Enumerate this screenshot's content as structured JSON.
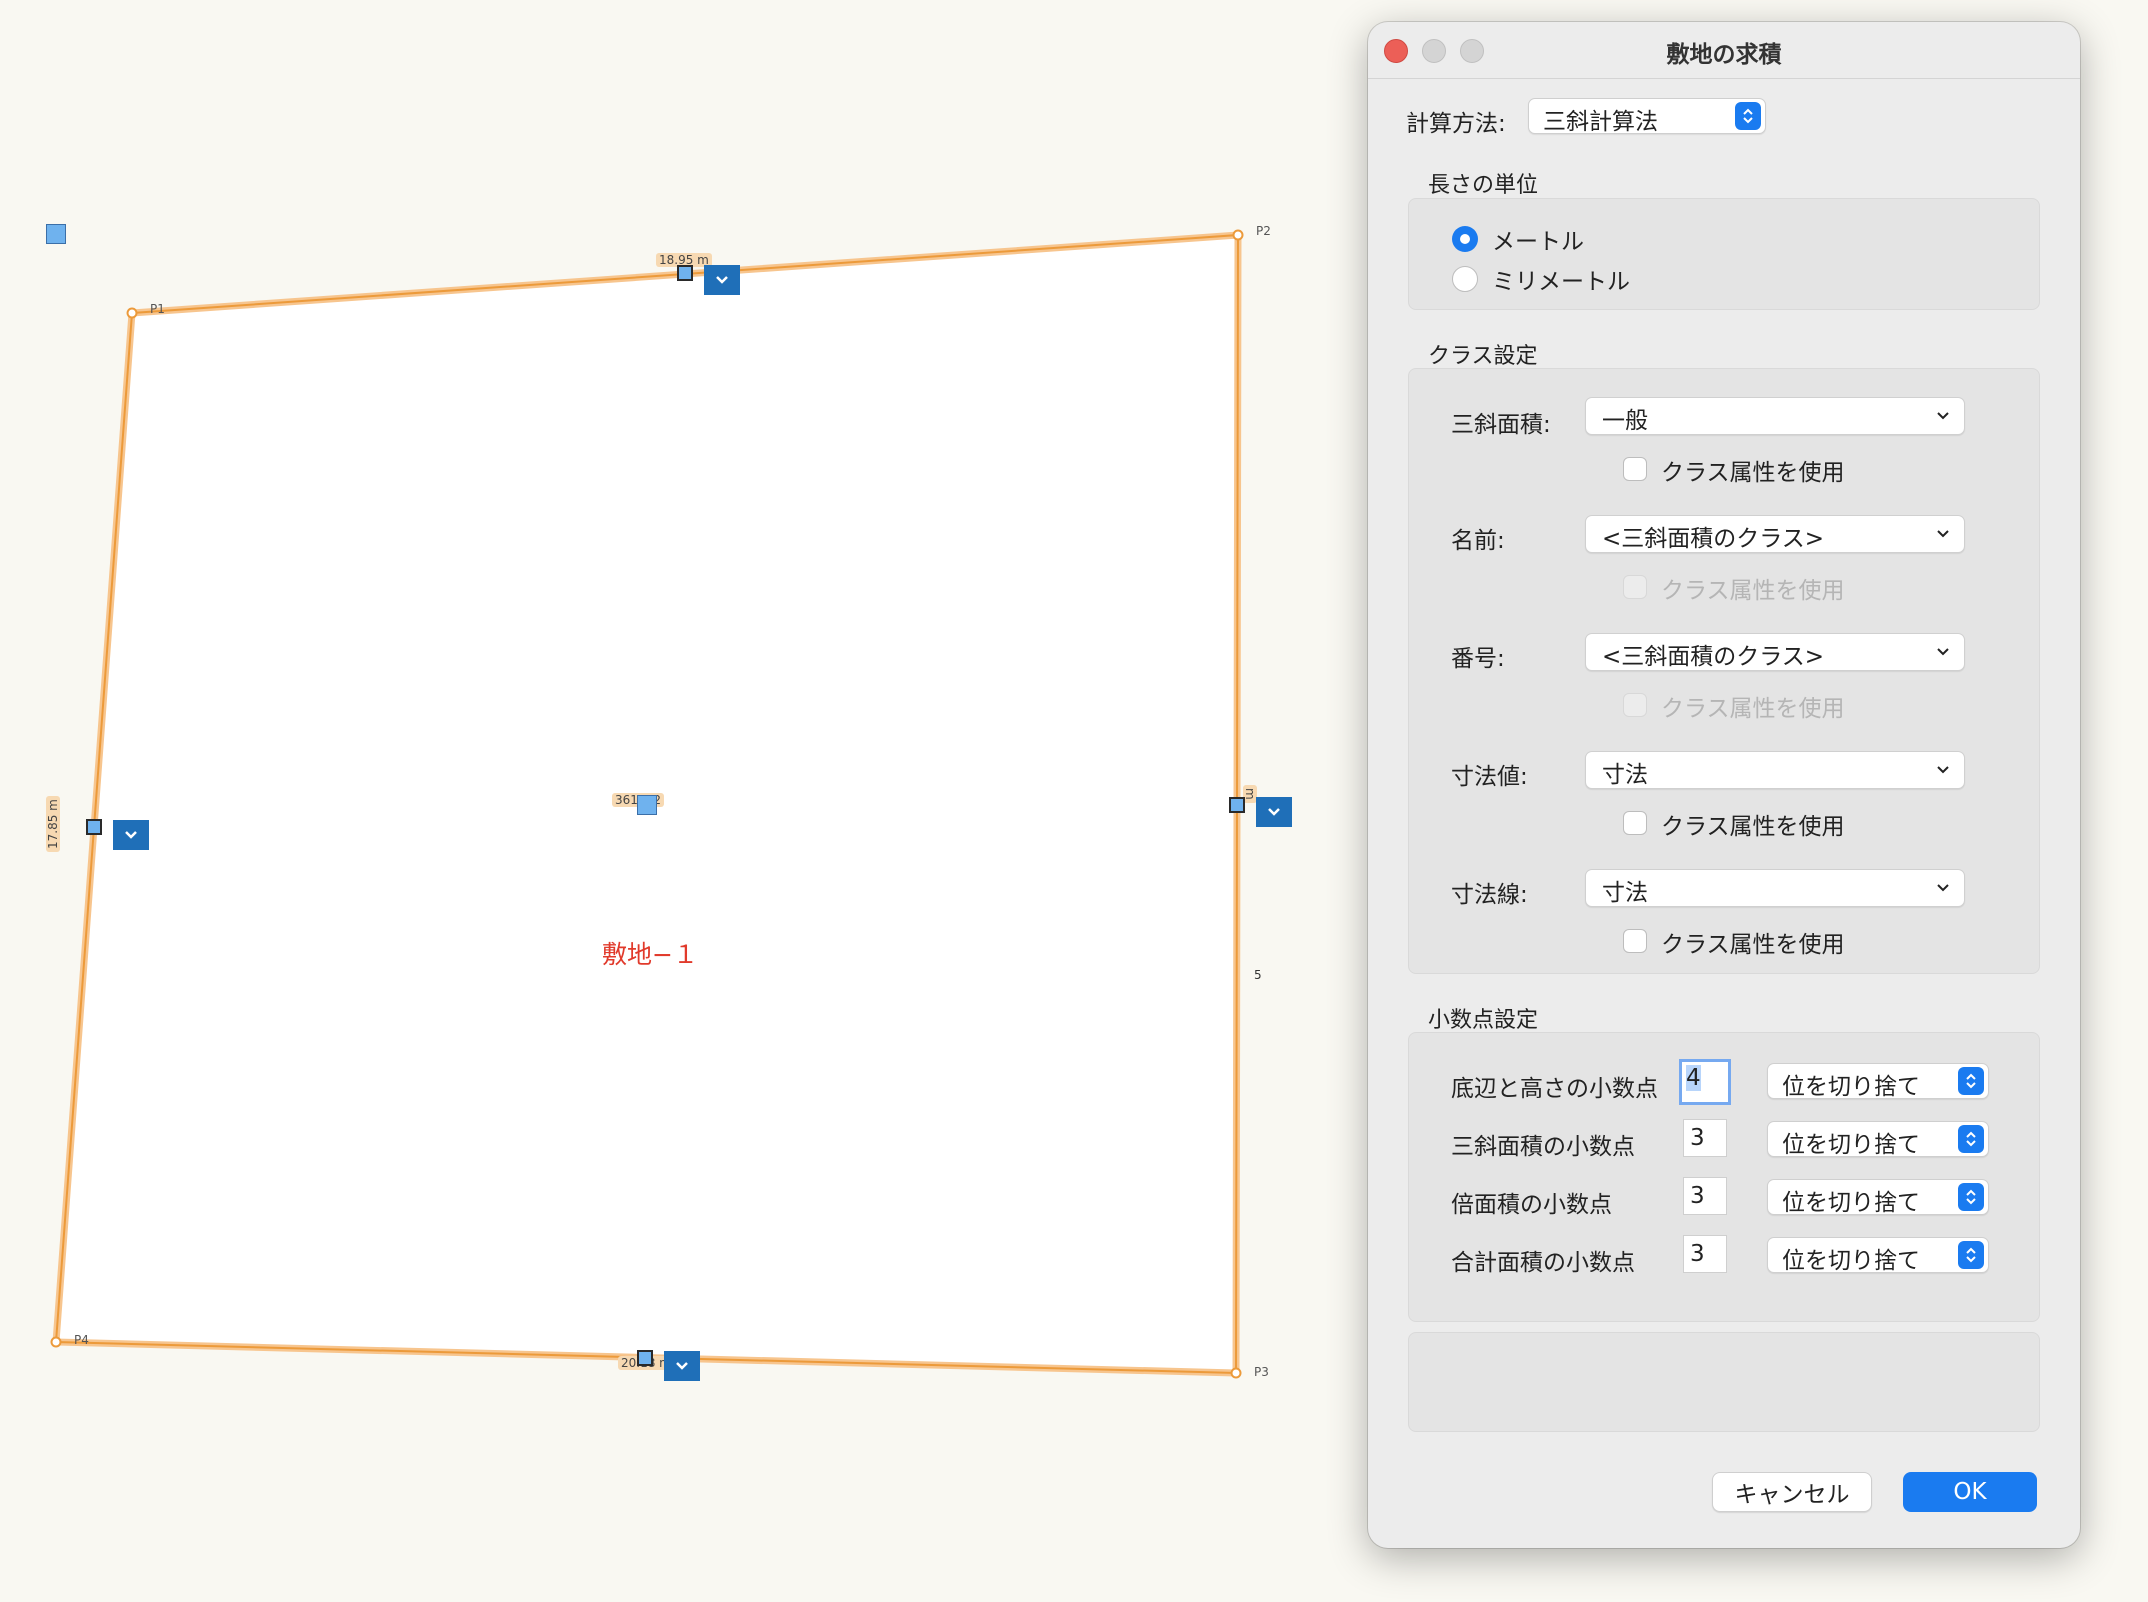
{
  "canvas": {
    "points": [
      "P1",
      "P2",
      "P3",
      "P4"
    ],
    "dimensions": {
      "top": "18.95 m",
      "left": "17.85 m",
      "right": "m",
      "bottom": "20.18 m",
      "area": "361 m2"
    },
    "right_marker": "5",
    "site_label": "敷地−１",
    "line_color": "#f0a23c",
    "label_color": "#e13a2b"
  },
  "dialog": {
    "title": "敷地の求積",
    "calc_method": {
      "label": "計算方法:",
      "value": "三斜計算法"
    },
    "length_unit": {
      "title": "長さの単位",
      "options": [
        {
          "label": "メートル",
          "selected": true
        },
        {
          "label": "ミリメートル",
          "selected": false
        }
      ]
    },
    "class_settings": {
      "title": "クラス設定",
      "rows": [
        {
          "label": "三斜面積:",
          "value": "一般",
          "checkbox": "クラス属性を使用",
          "enabled": true
        },
        {
          "label": "名前:",
          "value": "<三斜面積のクラス>",
          "checkbox": "クラス属性を使用",
          "enabled": false
        },
        {
          "label": "番号:",
          "value": "<三斜面積のクラス>",
          "checkbox": "クラス属性を使用",
          "enabled": false
        },
        {
          "label": "寸法値:",
          "value": "寸法",
          "checkbox": "クラス属性を使用",
          "enabled": true
        },
        {
          "label": "寸法線:",
          "value": "寸法",
          "checkbox": "クラス属性を使用",
          "enabled": true
        }
      ]
    },
    "decimal_settings": {
      "title": "小数点設定",
      "rows": [
        {
          "label": "底辺と高さの小数点",
          "value": "4",
          "rounding": "位を切り捨て"
        },
        {
          "label": "三斜面積の小数点",
          "value": "3",
          "rounding": "位を切り捨て"
        },
        {
          "label": "倍面積の小数点",
          "value": "3",
          "rounding": "位を切り捨て"
        },
        {
          "label": "合計面積の小数点",
          "value": "3",
          "rounding": "位を切り捨て"
        }
      ]
    },
    "buttons": {
      "cancel": "キャンセル",
      "ok": "OK"
    },
    "accent_color": "#1a7bf0"
  }
}
